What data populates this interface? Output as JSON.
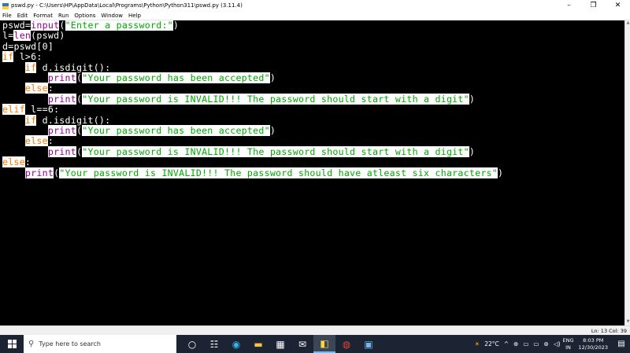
{
  "window": {
    "title": "pswd.py - C:\\Users\\HP\\AppData\\Local\\Programs\\Python\\Python311\\pswd.py (3.11.4)",
    "controls": {
      "minimize": "–",
      "maximize": "❐",
      "close": "✕"
    }
  },
  "menu": [
    "File",
    "Edit",
    "Format",
    "Run",
    "Options",
    "Window",
    "Help"
  ],
  "code": [
    [
      [
        "plain",
        "pswd="
      ],
      [
        "bi",
        "input"
      ],
      [
        "plain",
        "("
      ],
      [
        "str",
        "\"Enter a password:\""
      ],
      [
        "plain",
        ")"
      ]
    ],
    [
      [
        "plain",
        "l="
      ],
      [
        "bi",
        "len"
      ],
      [
        "plain",
        "(pswd)"
      ]
    ],
    [
      [
        "plain",
        "d=pswd[0]"
      ]
    ],
    [
      [
        "kw",
        "if"
      ],
      [
        "plain",
        " l>6:"
      ]
    ],
    [
      [
        "plain",
        "    "
      ],
      [
        "kw",
        "if"
      ],
      [
        "plain",
        " d.isdigit():"
      ]
    ],
    [
      [
        "plain",
        "        "
      ],
      [
        "bi",
        "print"
      ],
      [
        "plain",
        "("
      ],
      [
        "str",
        "\"Your password has been accepted\""
      ],
      [
        "plain",
        ")"
      ]
    ],
    [
      [
        "plain",
        "    "
      ],
      [
        "kw",
        "else"
      ],
      [
        "plain",
        ":"
      ]
    ],
    [
      [
        "plain",
        "        "
      ],
      [
        "bi",
        "print"
      ],
      [
        "plain",
        "("
      ],
      [
        "str",
        "\"Your password is INVALID!!! The password should start with a digit\""
      ],
      [
        "plain",
        ")"
      ]
    ],
    [
      [
        "kw",
        "elif"
      ],
      [
        "plain",
        " l==6:"
      ]
    ],
    [
      [
        "plain",
        "    "
      ],
      [
        "kw",
        "if"
      ],
      [
        "plain",
        " d.isdigit():"
      ]
    ],
    [
      [
        "plain",
        "        "
      ],
      [
        "bi",
        "print"
      ],
      [
        "plain",
        "("
      ],
      [
        "str",
        "\"Your password has been accepted\""
      ],
      [
        "plain",
        ")"
      ]
    ],
    [
      [
        "plain",
        "    "
      ],
      [
        "kw",
        "else"
      ],
      [
        "plain",
        ":"
      ]
    ],
    [
      [
        "plain",
        "        "
      ],
      [
        "bi",
        "print"
      ],
      [
        "plain",
        "("
      ],
      [
        "str",
        "\"Your password is INVALID!!! The password should start with a digit\""
      ],
      [
        "plain",
        ")"
      ]
    ],
    [
      [
        "kw",
        "else"
      ],
      [
        "plain",
        ":"
      ]
    ],
    [
      [
        "plain",
        "    "
      ],
      [
        "bi",
        "print"
      ],
      [
        "plain",
        "("
      ],
      [
        "str",
        "\"Your password is INVALID!!! The password should have atleast six characters\""
      ],
      [
        "plain",
        ")"
      ]
    ]
  ],
  "status": {
    "position": "Ln: 13   Col: 39"
  },
  "taskbar": {
    "search_placeholder": "Type here to search",
    "weather": "22°C",
    "lang_top": "ENG",
    "lang_bottom": "IN",
    "time": "8:03 PM",
    "date": "12/30/2023"
  },
  "colors": {
    "keyword": "#ff7700",
    "builtin": "#900090",
    "string": "#00aa00",
    "editor_bg": "#000000",
    "taskbar_bg": "#1c2332"
  }
}
